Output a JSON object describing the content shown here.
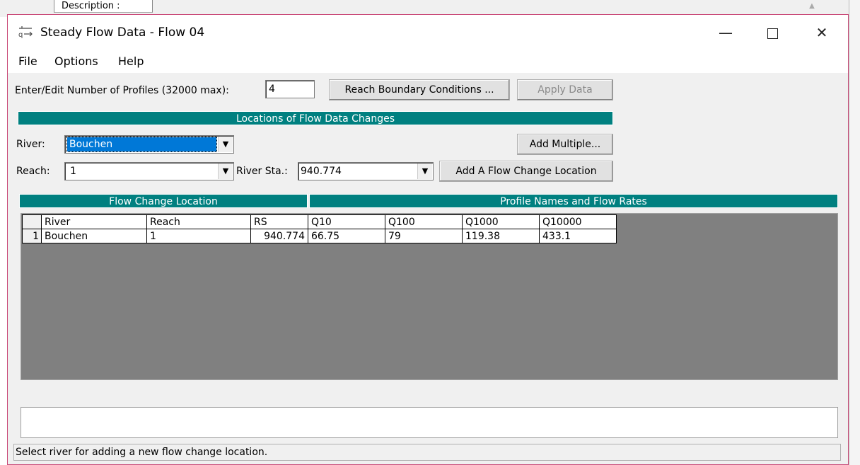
{
  "background": {
    "description_label": "Description :",
    "scroll_up": "▲"
  },
  "window": {
    "title": "Steady Flow Data - Flow 04",
    "controls": {
      "minimize": "—",
      "close": "✕"
    }
  },
  "menu": {
    "file": "File",
    "options": "Options",
    "help": "Help"
  },
  "profiles": {
    "label": "Enter/Edit Number of Profiles (32000 max):",
    "value": "4"
  },
  "buttons": {
    "reach_boundary": "Reach Boundary Conditions ...",
    "apply_data": "Apply Data",
    "add_multiple": "Add Multiple...",
    "add_flow_change": "Add A Flow Change Location"
  },
  "locations": {
    "header": "Locations of Flow Data Changes",
    "river_label": "River:",
    "river_value": "Bouchen",
    "reach_label": "Reach:",
    "reach_value": "1",
    "river_sta_label": "River Sta.:",
    "river_sta_value": "940.774"
  },
  "table": {
    "section_left": "Flow Change Location",
    "section_right": "Profile Names and Flow Rates",
    "columns": [
      "River",
      "Reach",
      "RS",
      "Q10",
      "Q100",
      "Q1000",
      "Q10000"
    ],
    "rows": [
      {
        "num": "1",
        "cells": [
          "Bouchen",
          "1",
          "940.774",
          "66.75",
          "79",
          "119.38",
          "433.1"
        ]
      }
    ]
  },
  "status": "Select river for adding a new flow change location."
}
